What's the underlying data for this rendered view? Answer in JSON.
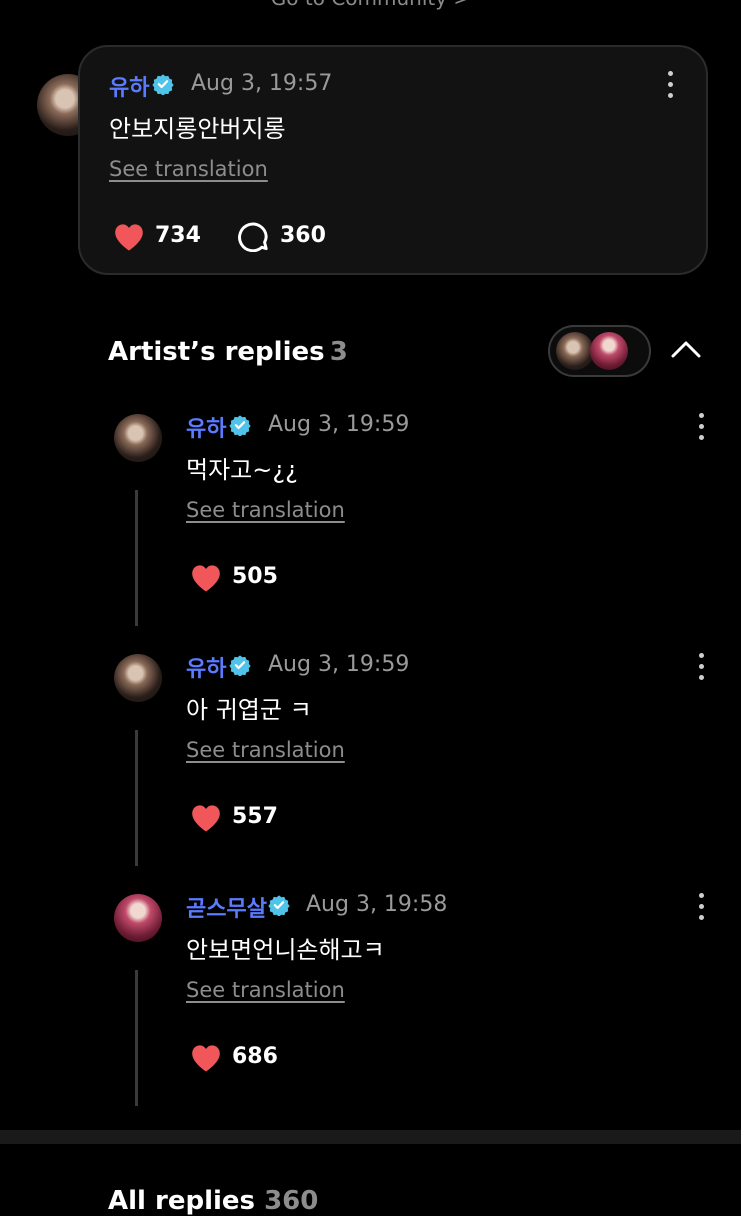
{
  "header": {
    "community_link": "Go to Community >"
  },
  "post": {
    "author": "유하",
    "time": "Aug 3, 19:57",
    "text": "안보지롱안버지롱",
    "translation": "See translation",
    "likes": "734",
    "comments": "360"
  },
  "artist_replies": {
    "title": "Artist’s replies",
    "count": "3",
    "replies": [
      {
        "author": "유하",
        "time": "Aug 3, 19:59",
        "text": "먹자고~¿¿",
        "translation": "See translation",
        "likes": "505"
      },
      {
        "author": "유하",
        "time": "Aug 3, 19:59",
        "text": "아 귀엽군 ㅋ",
        "translation": "See translation",
        "likes": "557"
      },
      {
        "author": "곧스무살",
        "time": "Aug 3, 19:58",
        "text": "안보면언니손해고ㅋ",
        "translation": "See translation",
        "likes": "686"
      }
    ]
  },
  "all_replies": {
    "title": "All replies",
    "count": "360"
  },
  "colors": {
    "name": "#5b7bff",
    "heart": "#f0565a",
    "verified": "#4fc3e8",
    "background": "#000000",
    "card": "#121212"
  }
}
